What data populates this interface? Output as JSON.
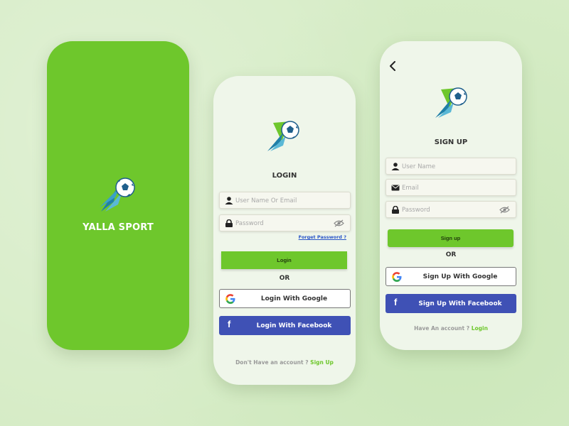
{
  "colors": {
    "background": "#d6ecc6",
    "brand_green": "#6ec72c",
    "screen_bg": "#eff6ea",
    "facebook_blue": "#3f51b5",
    "link_blue": "#2a55c8"
  },
  "splash": {
    "logo_icon": "soccer-ball-logo",
    "app_name": "YALLA SPORT"
  },
  "login": {
    "logo_icon": "soccer-ball-logo",
    "title": "LOGIN",
    "username": {
      "icon": "user-icon",
      "placeholder": "User Name Or Email",
      "value": ""
    },
    "password": {
      "icon": "lock-icon",
      "placeholder": "Password",
      "value": "",
      "toggle_icon": "eye-off-icon"
    },
    "forget_password": "Forget Password ?",
    "login_button": "Login",
    "or_label": "OR",
    "google_button": {
      "icon": "google-icon",
      "label": "Login With Google"
    },
    "facebook_button": {
      "icon": "facebook-icon",
      "label": "Login With Facebook"
    },
    "footer_text": "Don't Have an account ?",
    "footer_link": "Sign Up"
  },
  "signup": {
    "back_icon": "chevron-left-icon",
    "logo_icon": "soccer-ball-logo",
    "title": "SIGN UP",
    "username": {
      "icon": "user-icon",
      "placeholder": "User Name",
      "value": ""
    },
    "email": {
      "icon": "mail-icon",
      "placeholder": "Email",
      "value": ""
    },
    "password": {
      "icon": "lock-icon",
      "placeholder": "Password",
      "value": "",
      "toggle_icon": "eye-off-icon"
    },
    "signup_button": "Sign up",
    "or_label": "OR",
    "google_button": {
      "icon": "google-icon",
      "label": "Sign Up With Google"
    },
    "facebook_button": {
      "icon": "facebook-icon",
      "label": "Sign Up With Facebook"
    },
    "footer_text": "Have An account ?",
    "footer_link": "Login"
  }
}
